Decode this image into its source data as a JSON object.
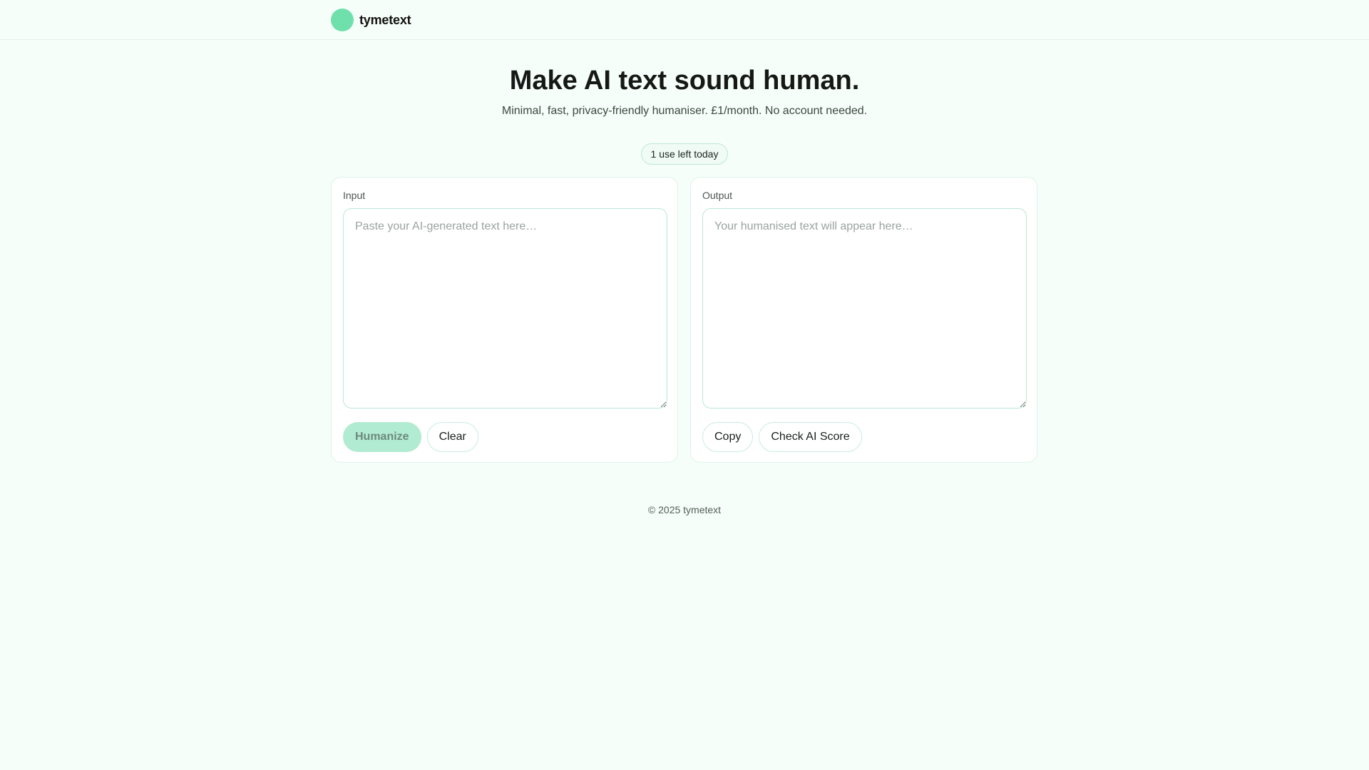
{
  "header": {
    "brand_name": "tymetext"
  },
  "hero": {
    "title": "Make AI text sound human.",
    "subtitle": "Minimal, fast, privacy-friendly humaniser. £1/month. No account needed."
  },
  "usage": {
    "label": "1 use left today"
  },
  "input_panel": {
    "label": "Input",
    "placeholder": "Paste your AI-generated text here…",
    "value": "",
    "humanize_label": "Humanize",
    "clear_label": "Clear"
  },
  "output_panel": {
    "label": "Output",
    "placeholder": "Your humanised text will appear here…",
    "value": "",
    "copy_label": "Copy",
    "check_label": "Check AI Score"
  },
  "footer": {
    "text": "© 2025 tymetext"
  },
  "colors": {
    "background": "#f6fef9",
    "accent": "#6fe0ac",
    "accent_disabled": "#b1ebd1",
    "border": "#b8e9d2"
  }
}
